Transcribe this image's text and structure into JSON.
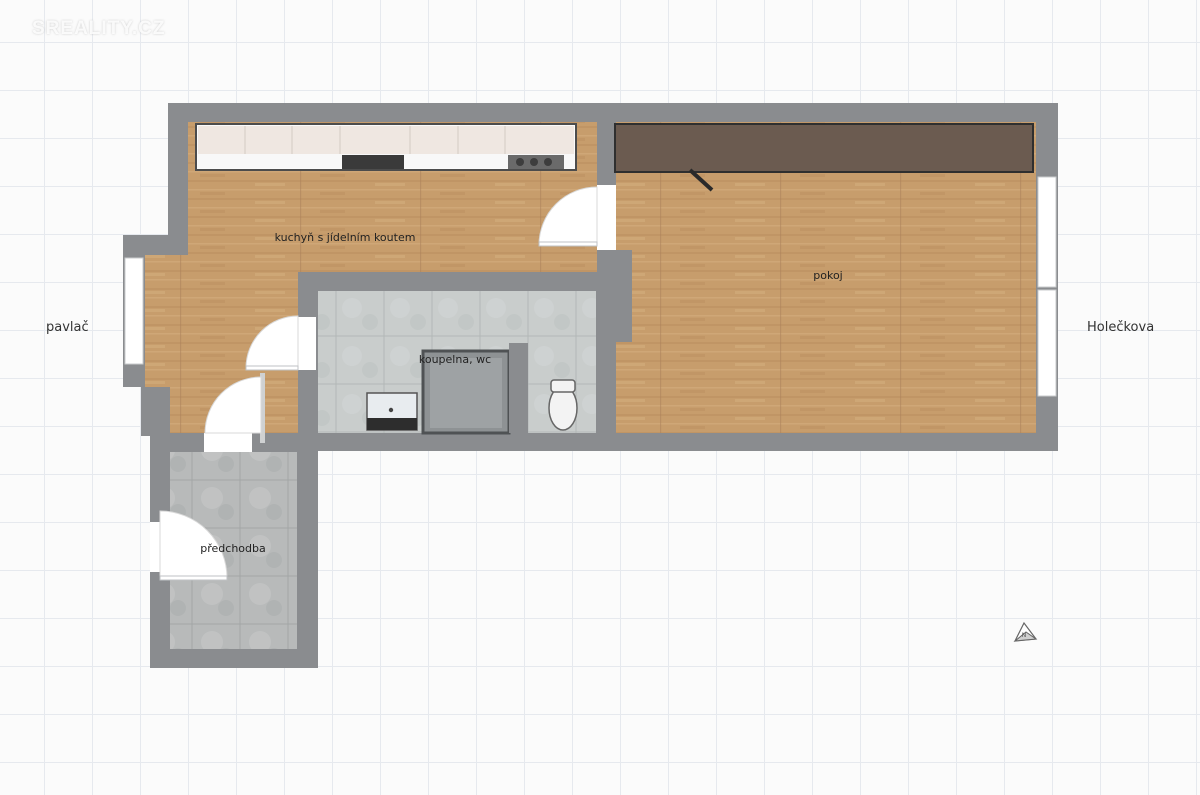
{
  "watermark": "SREALITY.CZ",
  "labels": {
    "left_side": "pavlač",
    "right_side": "Holečkova"
  },
  "rooms": {
    "kitchen": "kuchyň s jídelním koutem",
    "bathroom": "koupelna, wc",
    "room": "pokoj",
    "hallway": "předchodba"
  },
  "icons": {
    "compass": "north-arrow-icon"
  },
  "colors": {
    "wall": "#8a8c8f",
    "wood_floor": "#c49a6a",
    "tile_floor": "#c8cccb",
    "hall_floor": "#b9bbbb",
    "counter": "#efe8e3",
    "wardrobe": "#6b5b50"
  }
}
